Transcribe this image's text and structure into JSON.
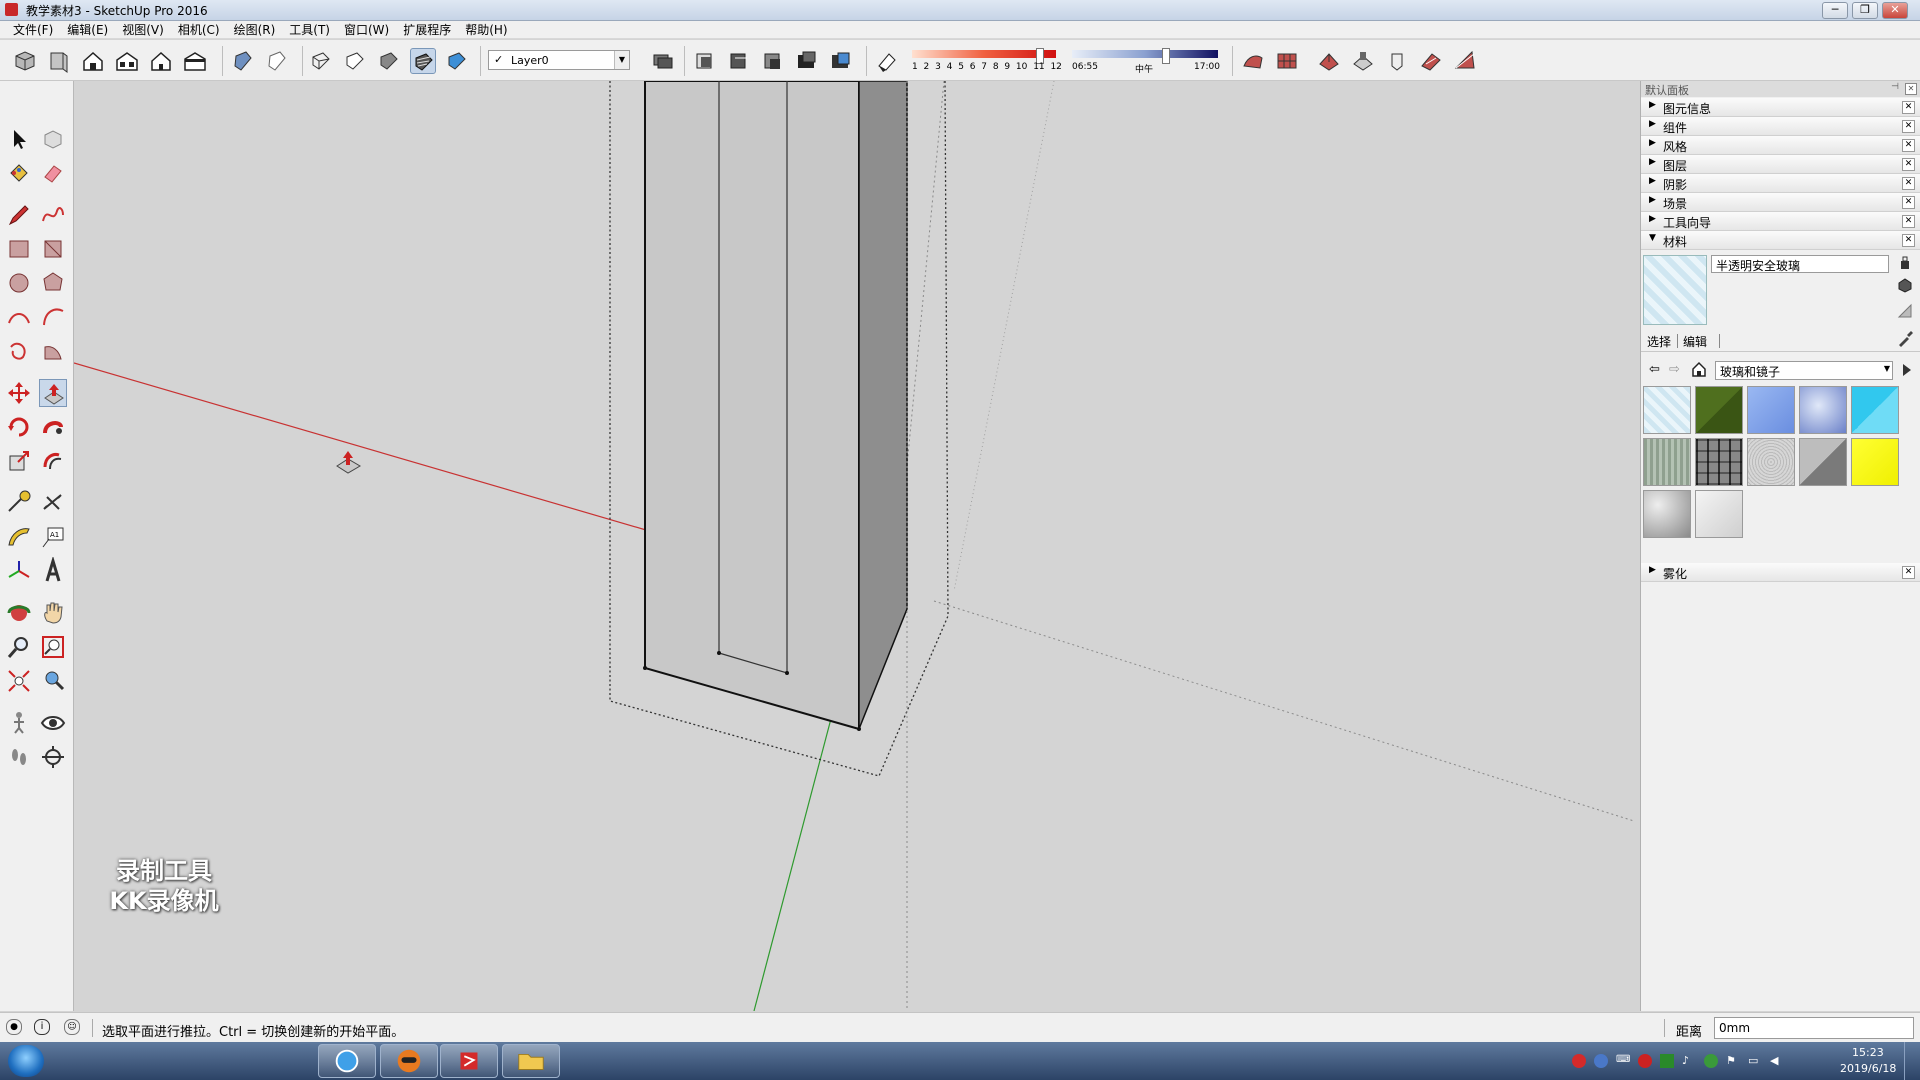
{
  "window": {
    "title": "教学素材3 - SketchUp Pro 2016",
    "minimize": "─",
    "restore": "❐",
    "close": "✕"
  },
  "menu": [
    "文件(F)",
    "编辑(E)",
    "视图(V)",
    "相机(C)",
    "绘图(R)",
    "工具(T)",
    "窗口(W)",
    "扩展程序",
    "帮助(H)"
  ],
  "toolbar": {
    "layer_check": "✓",
    "layer": "Layer0",
    "months": [
      "1",
      "2",
      "3",
      "4",
      "5",
      "6",
      "7",
      "8",
      "9",
      "10",
      "11",
      "12"
    ],
    "time_start": "06:55",
    "time_mid": "中午",
    "time_end": "17:00"
  },
  "tray": {
    "header": "默认面板",
    "panels": [
      "图元信息",
      "组件",
      "风格",
      "图层",
      "阴影",
      "场景",
      "工具向导"
    ],
    "materials_panel": "材料",
    "fog_panel": "雾化",
    "material_name": "半透明安全玻璃",
    "tab_select": "选择",
    "tab_edit": "编辑",
    "library": "玻璃和镜子",
    "swatch_colors": [
      "#cfe6f1",
      "#4f6f1e",
      "#7ea2ea",
      "#8c9fd6",
      "#31c8ee",
      "#8fa08f",
      "#6e6e6e",
      "#b4b4b4",
      "#8c8c8c",
      "#ffff33",
      "#a8a8a8",
      "#e2e2e2"
    ]
  },
  "status": {
    "message": "选取平面进行推拉。Ctrl = 切换创建新的开始平面。",
    "measure_label": "距离",
    "measure_value": "0mm"
  },
  "watermark": {
    "line1": "录制工具",
    "line2": "KK录像机"
  },
  "clock": {
    "time": "15:23",
    "date": "2019/6/18"
  }
}
